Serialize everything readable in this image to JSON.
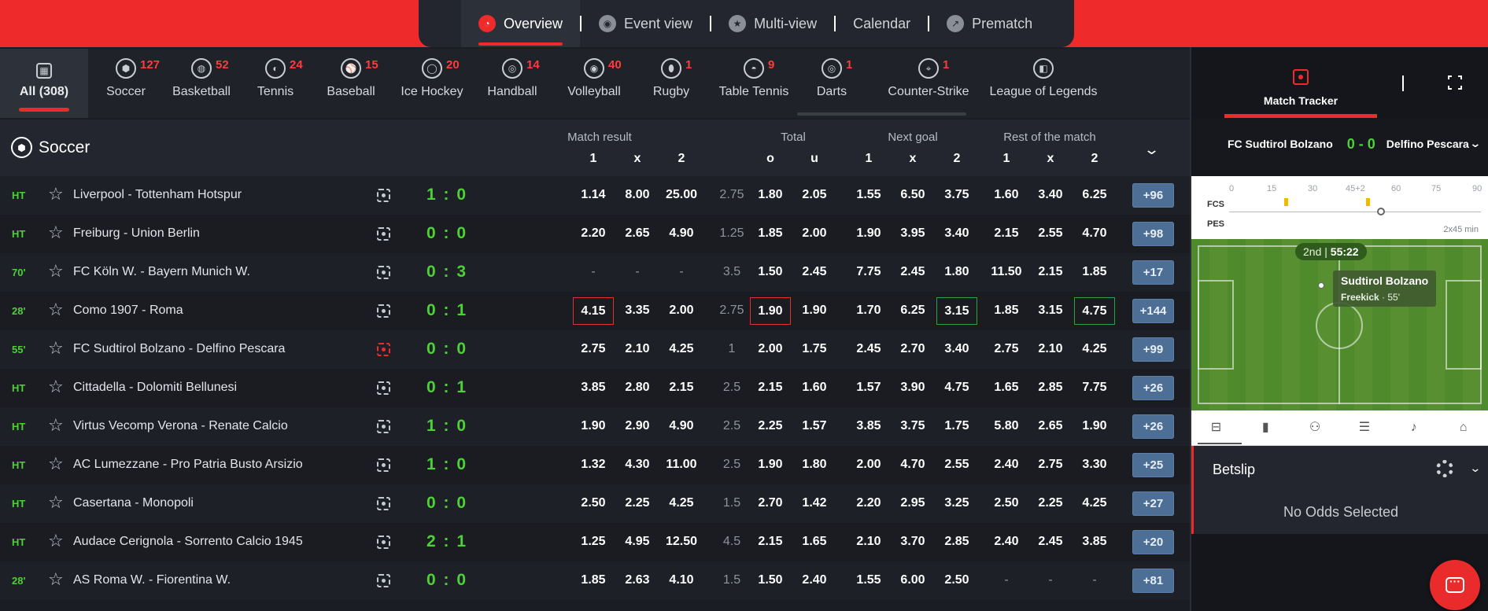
{
  "topnav": {
    "items": [
      {
        "label": "Overview",
        "icon": "clock-icon",
        "active": true
      },
      {
        "label": "Event view",
        "icon": "event-view-icon",
        "active": false
      },
      {
        "label": "Multi-view",
        "icon": "star-badge-icon",
        "active": false
      },
      {
        "label": "Calendar",
        "icon": "",
        "active": false
      },
      {
        "label": "Prematch",
        "icon": "arrow-icon",
        "active": false
      }
    ]
  },
  "sports": [
    {
      "name": "All (308)",
      "count": "",
      "icon": "grid-icon"
    },
    {
      "name": "Soccer",
      "count": "127",
      "icon": "soccer-ball-icon"
    },
    {
      "name": "Basketball",
      "count": "52",
      "icon": "basketball-icon"
    },
    {
      "name": "Tennis",
      "count": "24",
      "icon": "tennis-ball-icon"
    },
    {
      "name": "Baseball",
      "count": "15",
      "icon": "baseball-icon"
    },
    {
      "name": "Ice Hockey",
      "count": "20",
      "icon": "ice-hockey-icon"
    },
    {
      "name": "Handball",
      "count": "14",
      "icon": "handball-icon"
    },
    {
      "name": "Volleyball",
      "count": "40",
      "icon": "volleyball-icon"
    },
    {
      "name": "Rugby",
      "count": "1",
      "icon": "rugby-ball-icon"
    },
    {
      "name": "Table Tennis",
      "count": "9",
      "icon": "table-tennis-icon"
    },
    {
      "name": "Darts",
      "count": "1",
      "icon": "darts-icon"
    },
    {
      "name": "Counter-Strike",
      "count": "1",
      "icon": "counter-strike-icon"
    },
    {
      "name": "League of Legends",
      "count": "",
      "icon": "league-of-legends-icon"
    }
  ],
  "section": {
    "title": "Soccer",
    "groups": [
      "Match result",
      "Total",
      "Next goal",
      "Rest of the match"
    ],
    "cols": [
      "1",
      "x",
      "2",
      "o",
      "u",
      "1",
      "x",
      "2",
      "1",
      "x",
      "2"
    ]
  },
  "matches": [
    {
      "status": "HT",
      "name": "Liverpool - Tottenham Hotspur",
      "score": "1 : 0",
      "live": false,
      "mr": [
        "1.14",
        "8.00",
        "25.00"
      ],
      "line": "2.75",
      "ou": [
        "1.80",
        "2.05"
      ],
      "ng": [
        "1.55",
        "6.50",
        "3.75"
      ],
      "rm": [
        "1.60",
        "3.40",
        "6.25"
      ],
      "more": "+96"
    },
    {
      "status": "HT",
      "name": "Freiburg - Union Berlin",
      "score": "0 : 0",
      "live": false,
      "mr": [
        "2.20",
        "2.65",
        "4.90"
      ],
      "line": "1.25",
      "ou": [
        "1.85",
        "2.00"
      ],
      "ng": [
        "1.90",
        "3.95",
        "3.40"
      ],
      "rm": [
        "2.15",
        "2.55",
        "4.70"
      ],
      "more": "+98"
    },
    {
      "status": "70'",
      "name": "FC Köln W. - Bayern Munich W.",
      "score": "0 : 3",
      "live": false,
      "mr": [
        "-",
        "-",
        "-"
      ],
      "line": "3.5",
      "ou": [
        "1.50",
        "2.45"
      ],
      "ng": [
        "7.75",
        "2.45",
        "1.80"
      ],
      "rm": [
        "11.50",
        "2.15",
        "1.85"
      ],
      "more": "+17"
    },
    {
      "status": "28'",
      "name": "Como 1907 - Roma",
      "score": "0 : 1",
      "live": false,
      "mr": [
        "4.15",
        "3.35",
        "2.00"
      ],
      "line": "2.75",
      "ou": [
        "1.90",
        "1.90"
      ],
      "ng": [
        "1.70",
        "6.25",
        "3.15"
      ],
      "rm": [
        "1.85",
        "3.15",
        "4.75"
      ],
      "more": "+144"
    },
    {
      "status": "55'",
      "name": "FC Sudtirol Bolzano - Delfino Pescara",
      "score": "0 : 0",
      "live": true,
      "mr": [
        "2.75",
        "2.10",
        "4.25"
      ],
      "line": "1",
      "ou": [
        "2.00",
        "1.75"
      ],
      "ng": [
        "2.45",
        "2.70",
        "3.40"
      ],
      "rm": [
        "2.75",
        "2.10",
        "4.25"
      ],
      "more": "+99"
    },
    {
      "status": "HT",
      "name": "Cittadella - Dolomiti Bellunesi",
      "score": "0 : 1",
      "live": false,
      "mr": [
        "3.85",
        "2.80",
        "2.15"
      ],
      "line": "2.5",
      "ou": [
        "2.15",
        "1.60"
      ],
      "ng": [
        "1.57",
        "3.90",
        "4.75"
      ],
      "rm": [
        "1.65",
        "2.85",
        "7.75"
      ],
      "more": "+26"
    },
    {
      "status": "HT",
      "name": "Virtus Vecomp Verona - Renate Calcio",
      "score": "1 : 0",
      "live": false,
      "mr": [
        "1.90",
        "2.90",
        "4.90"
      ],
      "line": "2.5",
      "ou": [
        "2.25",
        "1.57"
      ],
      "ng": [
        "3.85",
        "3.75",
        "1.75"
      ],
      "rm": [
        "5.80",
        "2.65",
        "1.90"
      ],
      "more": "+26"
    },
    {
      "status": "HT",
      "name": "AC Lumezzane - Pro Patria Busto Arsizio",
      "score": "1 : 0",
      "live": false,
      "mr": [
        "1.32",
        "4.30",
        "11.00"
      ],
      "line": "2.5",
      "ou": [
        "1.90",
        "1.80"
      ],
      "ng": [
        "2.00",
        "4.70",
        "2.55"
      ],
      "rm": [
        "2.40",
        "2.75",
        "3.30"
      ],
      "more": "+25"
    },
    {
      "status": "HT",
      "name": "Casertana - Monopoli",
      "score": "0 : 0",
      "live": false,
      "mr": [
        "2.50",
        "2.25",
        "4.25"
      ],
      "line": "1.5",
      "ou": [
        "2.70",
        "1.42"
      ],
      "ng": [
        "2.20",
        "2.95",
        "3.25"
      ],
      "rm": [
        "2.50",
        "2.25",
        "4.25"
      ],
      "more": "+27"
    },
    {
      "status": "HT",
      "name": "Audace Cerignola - Sorrento Calcio 1945",
      "score": "2 : 1",
      "live": false,
      "mr": [
        "1.25",
        "4.95",
        "12.50"
      ],
      "line": "4.5",
      "ou": [
        "2.15",
        "1.65"
      ],
      "ng": [
        "2.10",
        "3.70",
        "2.85"
      ],
      "rm": [
        "2.40",
        "2.45",
        "3.85"
      ],
      "more": "+20"
    },
    {
      "status": "28'",
      "name": "AS Roma W. - Fiorentina W.",
      "score": "0 : 0",
      "live": false,
      "mr": [
        "1.85",
        "2.63",
        "4.10"
      ],
      "line": "1.5",
      "ou": [
        "1.50",
        "2.40"
      ],
      "ng": [
        "1.55",
        "6.00",
        "2.50"
      ],
      "rm": [
        "-",
        "-",
        "-"
      ],
      "more": "+81"
    }
  ],
  "tracker": {
    "tab_label": "Match Tracker",
    "team_a": "FC Sudtirol Bolzano",
    "score": "0 - 0",
    "team_b": "Delfino Pescara",
    "timeline_ticks": [
      "0",
      "15",
      "30",
      "45+2",
      "60",
      "75",
      "90"
    ],
    "timeline_teams": [
      "FCS",
      "PES"
    ],
    "duration": "2x45 min",
    "period": "2nd",
    "clock": "55:22",
    "event_team": "Sudtirol Bolzano",
    "event_type": "Freekick",
    "event_minute": "· 55'"
  },
  "betslip": {
    "title": "Betslip",
    "empty": "No Odds Selected"
  },
  "colors": {
    "accent": "#ef2a2a",
    "live_green": "#4cd137",
    "more_button": "#4d6f96"
  }
}
